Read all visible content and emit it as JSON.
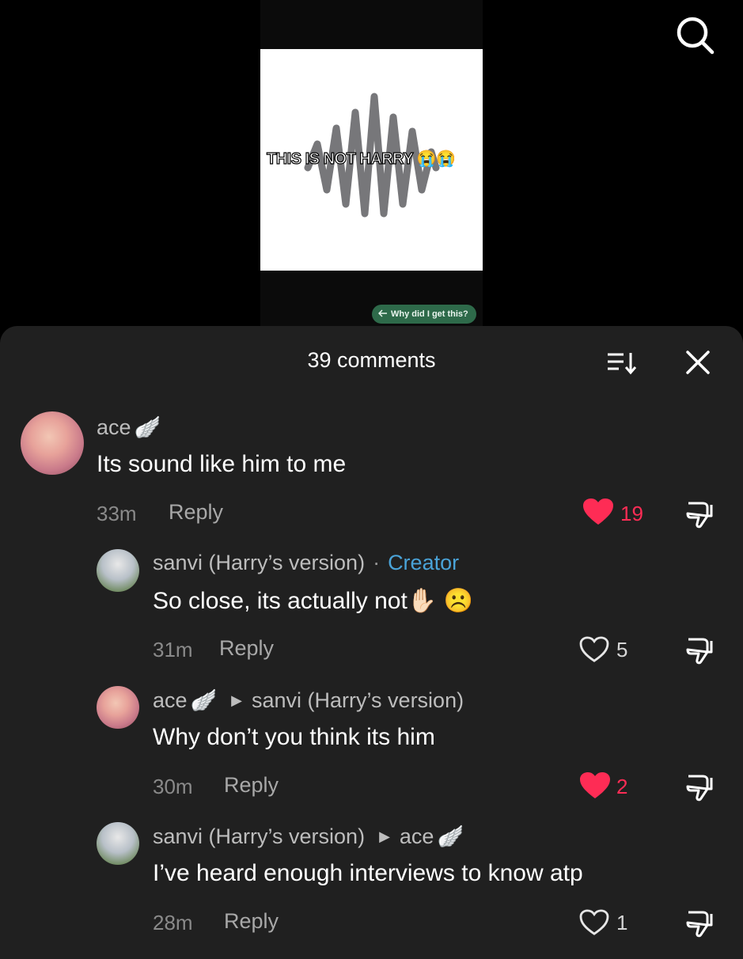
{
  "video": {
    "overlay_text": "THIS IS NOT HARRY 😭😭",
    "why_label": "Why did I get this?",
    "search_icon": "search-icon"
  },
  "sheet": {
    "title": "39 comments",
    "sort_icon": "sort-icon",
    "close_icon": "close-icon"
  },
  "comments": [
    {
      "user": "ace",
      "user_badge": "🪽",
      "text": "Its sound like him to me",
      "time": "33m",
      "reply_label": "Reply",
      "likes": "19",
      "liked": true
    },
    {
      "user": "sanvi (Harry’s version)",
      "creator_sep": "·",
      "creator_label": "Creator",
      "text": "So close, its actually not✋🏻 ☹️",
      "time": "31m",
      "reply_label": "Reply",
      "likes": "5",
      "liked": false
    },
    {
      "user": "ace",
      "user_badge": "🪽",
      "reply_to": "sanvi (Harry’s version)",
      "text": "Why don’t you think its him",
      "time": "30m",
      "reply_label": "Reply",
      "likes": "2",
      "liked": true
    },
    {
      "user": "sanvi (Harry’s version)",
      "reply_to": "ace",
      "reply_to_badge": "🪽",
      "text": "I’ve heard enough interviews to know atp",
      "time": "28m",
      "reply_label": "Reply",
      "likes": "1",
      "liked": false
    }
  ],
  "colors": {
    "like_active": "#fe2c55",
    "creator": "#4aa3d8",
    "sheet_bg": "#202020"
  }
}
